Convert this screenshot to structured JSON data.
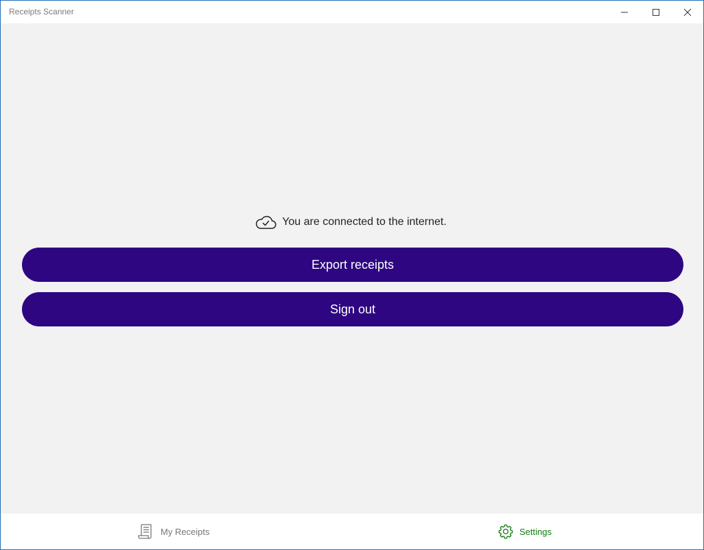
{
  "window": {
    "title": "Receipts Scanner",
    "controls": [
      "minimize-icon",
      "maximize-icon",
      "close-icon"
    ]
  },
  "settings": {
    "status_icon": "cloud-check-icon",
    "status_text": "You are connected to the internet.",
    "export_label": "Export receipts",
    "signout_label": "Sign out"
  },
  "nav": {
    "items": [
      {
        "label": "My Receipts",
        "icon": "receipt-icon",
        "active": false
      },
      {
        "label": "Settings",
        "icon": "gear-icon",
        "active": true
      }
    ]
  },
  "colors": {
    "accent_button": "#2e0682",
    "active_nav": "#107c10",
    "inactive_nav": "#777777",
    "background": "#f2f2f2",
    "window_border": "#1f6fb5"
  }
}
